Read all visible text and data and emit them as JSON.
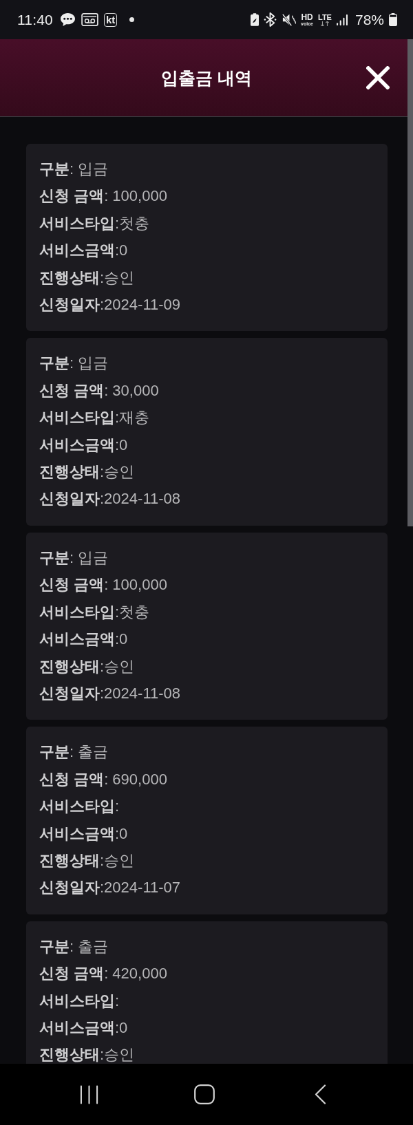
{
  "status_bar": {
    "time": "11:40",
    "carrier_badge": "kt",
    "hd_label": "HD",
    "voice_label": "voice",
    "network_label": "LTE",
    "battery": "78%"
  },
  "header": {
    "title": "입출금 내역"
  },
  "records": [
    {
      "lines": [
        "**구분**: 입금",
        "**신청 금액**: 100,000",
        "**서비스타입**:첫충",
        "**서비스금액**:0",
        "**진행상태**:승인",
        "**신청일자**:2024-11-09"
      ]
    },
    {
      "lines": [
        "**구분**: 입금",
        "**신청 금액**: 30,000",
        "**서비스타입**:재충",
        "**서비스금액**:0",
        "**진행상태**:승인",
        "**신청일자**:2024-11-08"
      ]
    },
    {
      "lines": [
        "**구분**: 입금",
        "**신청 금액**: 100,000",
        "**서비스타입**:첫충",
        "**서비스금액**:0",
        "**진행상태**:승인",
        "**신청일자**:2024-11-08"
      ]
    },
    {
      "lines": [
        "**구분**: 출금",
        "**신청 금액**: 690,000",
        "**서비스타입**:",
        "**서비스금액**:0",
        "**진행상태**:승인",
        "**신청일자**:2024-11-07"
      ]
    },
    {
      "lines": [
        "**구분**: 출금",
        "**신청 금액**: 420,000",
        "**서비스타입**:",
        "**서비스금액**:0",
        "**진행상태**:승인"
      ]
    }
  ]
}
